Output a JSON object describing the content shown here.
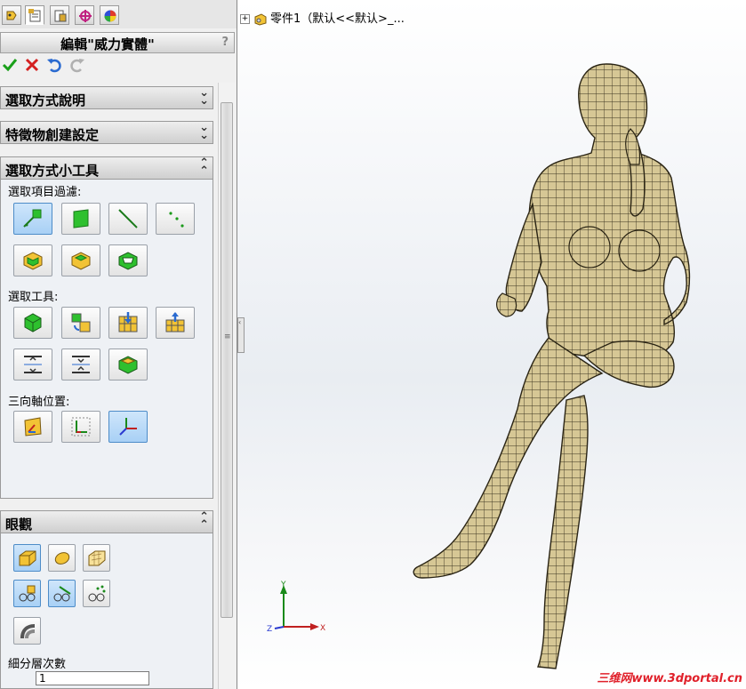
{
  "title": "編輯\"威力實體\"",
  "help_symbol": "?",
  "sections": {
    "select_help": "選取方式說明",
    "feature_settings": "特徵物創建設定",
    "select_tools": "選取方式小工具",
    "display": "眼觀"
  },
  "labels": {
    "filter": "選取項目過濾:",
    "select_tool": "選取工具:",
    "triad": "三向軸位置:",
    "subdivision": "細分層次數"
  },
  "subdivision_value": "1",
  "tree": {
    "root_label": "零件1（默认<<默认>_..."
  },
  "triad_axes": {
    "x": "X",
    "y": "Y",
    "z": "Z"
  },
  "watermark": "三维网www.3dportal.cn",
  "colors": {
    "accent": "#4d8cc8",
    "mesh": "#d6c795",
    "mesh_line": "#3a3320"
  }
}
